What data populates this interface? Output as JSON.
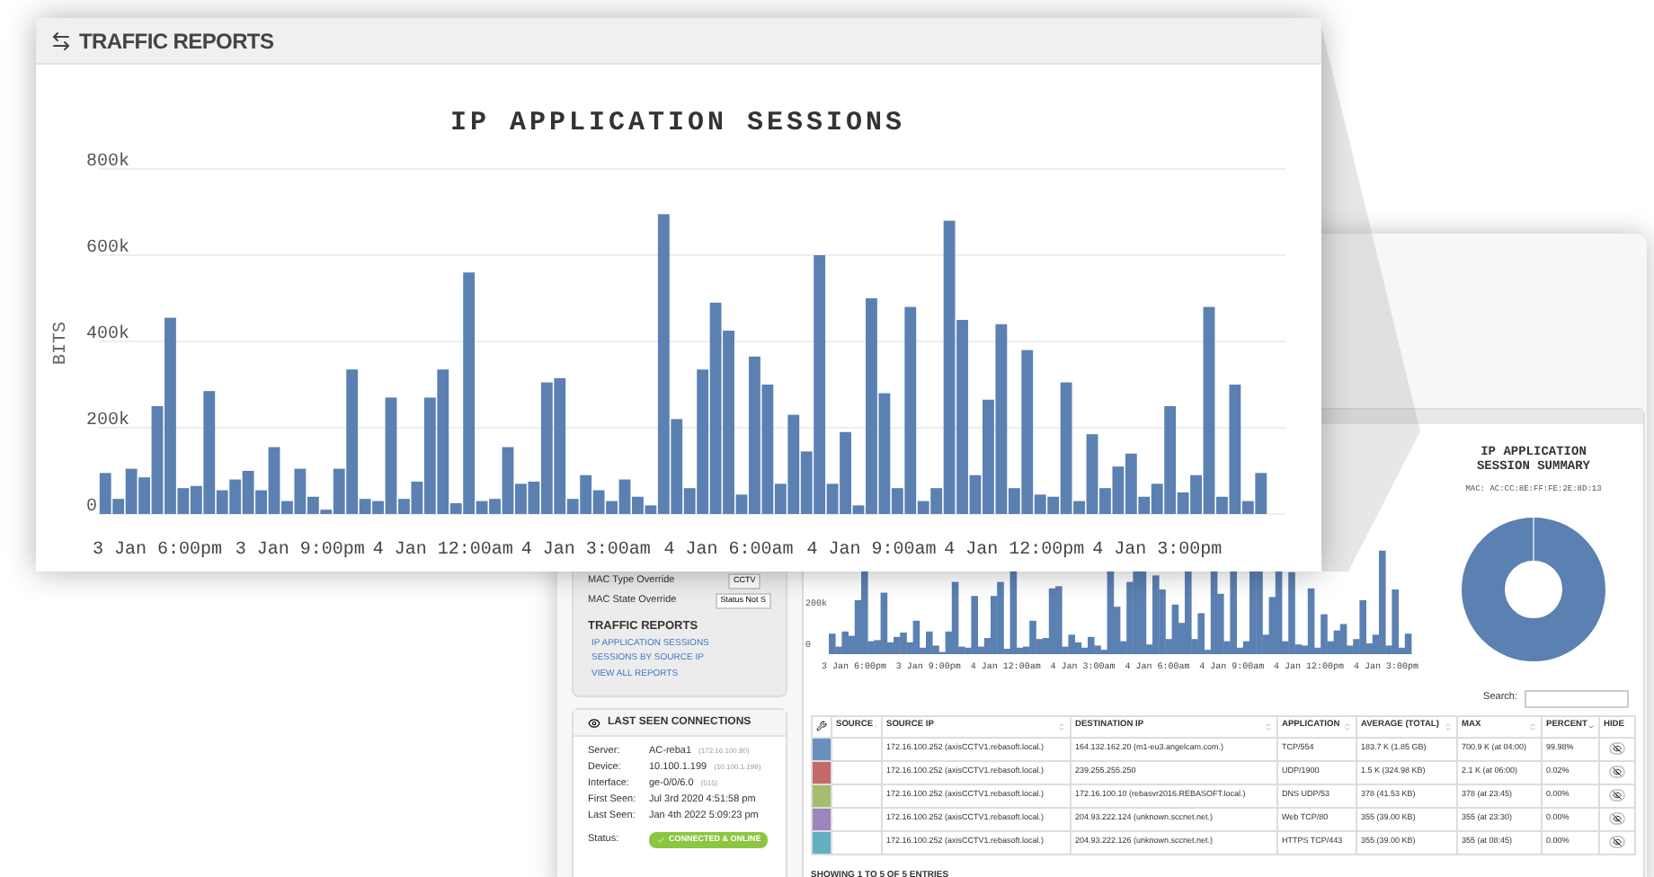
{
  "zoom_card": {
    "title": "TRAFFIC REPORTS",
    "chart_data": {
      "type": "bar",
      "title": "IP APPLICATION SESSIONS",
      "ylabel": "BITS",
      "grid": true,
      "categories": [
        null,
        null,
        null,
        null,
        "3 Jan 6:00pm",
        null,
        null,
        null,
        null,
        null,
        null,
        null,
        null,
        null,
        null,
        "3 Jan 9:00pm",
        null,
        null,
        null,
        null,
        null,
        null,
        null,
        null,
        null,
        null,
        "4 Jan 12:00am",
        null,
        null,
        null,
        null,
        null,
        null,
        null,
        null,
        null,
        null,
        "4 Jan 3:00am",
        null,
        null,
        null,
        null,
        null,
        null,
        null,
        null,
        null,
        null,
        "4 Jan 6:00am",
        null,
        null,
        null,
        null,
        null,
        null,
        null,
        null,
        null,
        null,
        "4 Jan 9:00am",
        null,
        null,
        null,
        null,
        null,
        null,
        null,
        null,
        null,
        null,
        "4 Jan 12:00pm",
        null,
        null,
        null,
        null,
        null,
        null,
        null,
        null,
        null,
        null,
        "4 Jan 3:00pm",
        null,
        null,
        null,
        null,
        null,
        null,
        null,
        null
      ],
      "values": [
        95,
        35,
        105,
        85,
        250,
        455,
        60,
        65,
        285,
        55,
        80,
        100,
        55,
        155,
        30,
        105,
        40,
        10,
        105,
        335,
        35,
        30,
        270,
        35,
        75,
        270,
        335,
        25,
        560,
        30,
        35,
        155,
        70,
        75,
        305,
        315,
        35,
        90,
        55,
        30,
        80,
        40,
        20,
        695,
        220,
        60,
        335,
        490,
        425,
        45,
        365,
        300,
        70,
        230,
        145,
        600,
        70,
        190,
        20,
        500,
        280,
        60,
        480,
        30,
        60,
        680,
        450,
        90,
        265,
        440,
        60,
        380,
        45,
        40,
        305,
        30,
        185,
        60,
        110,
        140,
        40,
        70,
        250,
        50,
        90,
        480,
        40,
        300,
        30,
        95
      ],
      "ylim": [
        0,
        800
      ],
      "yticks": [
        {
          "value": 0,
          "label": "0"
        },
        {
          "value": 200,
          "label": "200k"
        },
        {
          "value": 400,
          "label": "400k"
        },
        {
          "value": 600,
          "label": "600k"
        },
        {
          "value": 800,
          "label": "800k"
        }
      ]
    }
  },
  "device_info": {
    "rows": [
      {
        "label": "MAC Type Override",
        "value": "CCTV"
      },
      {
        "label": "MAC State Override",
        "value": "Status Not S"
      }
    ],
    "reports_title": "TRAFFIC REPORTS",
    "links": [
      "IP APPLICATION SESSIONS",
      "SESSIONS BY SOURCE IP",
      "VIEW ALL REPORTS"
    ]
  },
  "last_seen": {
    "title": "LAST SEEN CONNECTIONS",
    "rows": [
      {
        "label": "Server:",
        "value": "AC-reba1",
        "note": "(172.16.100.80)"
      },
      {
        "label": "Device:",
        "value": "10.100.1.199",
        "note": "(10.100.1.199)"
      },
      {
        "label": "Interface:",
        "value": "ge-0/0/6.0",
        "note": "(515)"
      },
      {
        "label": "First Seen:",
        "value": "Jul 3rd 2020 4:51:58 pm"
      },
      {
        "label": "Last Seen:",
        "value": "Jan 4th 2022 5:09:23 pm"
      }
    ],
    "status_label": "Status:",
    "status": "CONNECTED & ONLINE"
  },
  "small_chart": {
    "y_labels": [
      "200k",
      "0"
    ],
    "x_labels": [
      "3 Jan 6:00pm",
      "3 Jan 9:00pm",
      "4 Jan 12:00am",
      "4 Jan 3:00am",
      "4 Jan 6:00am",
      "4 Jan 9:00am",
      "4 Jan 12:00pm",
      "4 Jan 3:00pm"
    ]
  },
  "summary": {
    "title": "IP APPLICATION SESSION SUMMARY",
    "mac": "MAC: AC:CC:8E:FF:FE:2E:8D:13"
  },
  "search": {
    "label": "Search:"
  },
  "table": {
    "columns": [
      "SOURCE",
      "SOURCE IP",
      "DESTINATION IP",
      "APPLICATION",
      "AVERAGE (TOTAL)",
      "MAX",
      "PERCENT",
      "HIDE"
    ],
    "rows": [
      {
        "color": "#6a8fbd",
        "source_ip": "172.16.100.252 (axisCCTV1.rebasoft.local.)",
        "destination_ip": "164.132.162.20 (m1-eu3.angelcam.com.)",
        "application": "TCP/554",
        "average": "183.7 K (1.85 GB)",
        "max": "700.9 K (at 04:00)",
        "percent": "99.98%"
      },
      {
        "color": "#c56a6a",
        "source_ip": "172.16.100.252 (axisCCTV1.rebasoft.local.)",
        "destination_ip": "239.255.255.250",
        "application": "UDP/1900",
        "average": "1.5 K (324.98 KB)",
        "max": "2.1 K (at 06:00)",
        "percent": "0.02%"
      },
      {
        "color": "#a6bd6f",
        "source_ip": "172.16.100.252 (axisCCTV1.rebasoft.local.)",
        "destination_ip": "172.16.100.10 (rebasvr2016.REBASOFT.local.)",
        "application": "DNS UDP/53",
        "average": "378 (41.53 KB)",
        "max": "378 (at 23:45)",
        "percent": "0.00%"
      },
      {
        "color": "#9c86bd",
        "source_ip": "172.16.100.252 (axisCCTV1.rebasoft.local.)",
        "destination_ip": "204.93.222.124 (unknown.sccnet.net.)",
        "application": "Web TCP/80",
        "average": "355 (39.00 KB)",
        "max": "355 (at 23:30)",
        "percent": "0.00%"
      },
      {
        "color": "#63aec0",
        "source_ip": "172.16.100.252 (axisCCTV1.rebasoft.local.)",
        "destination_ip": "204.93.222.126 (unknown.sccnet.net.)",
        "application": "HTTPS TCP/443",
        "average": "355 (39.00 KB)",
        "max": "355 (at 08:45)",
        "percent": "0.00%"
      }
    ],
    "footer": "SHOWING 1 TO 5 OF 5 ENTRIES"
  }
}
